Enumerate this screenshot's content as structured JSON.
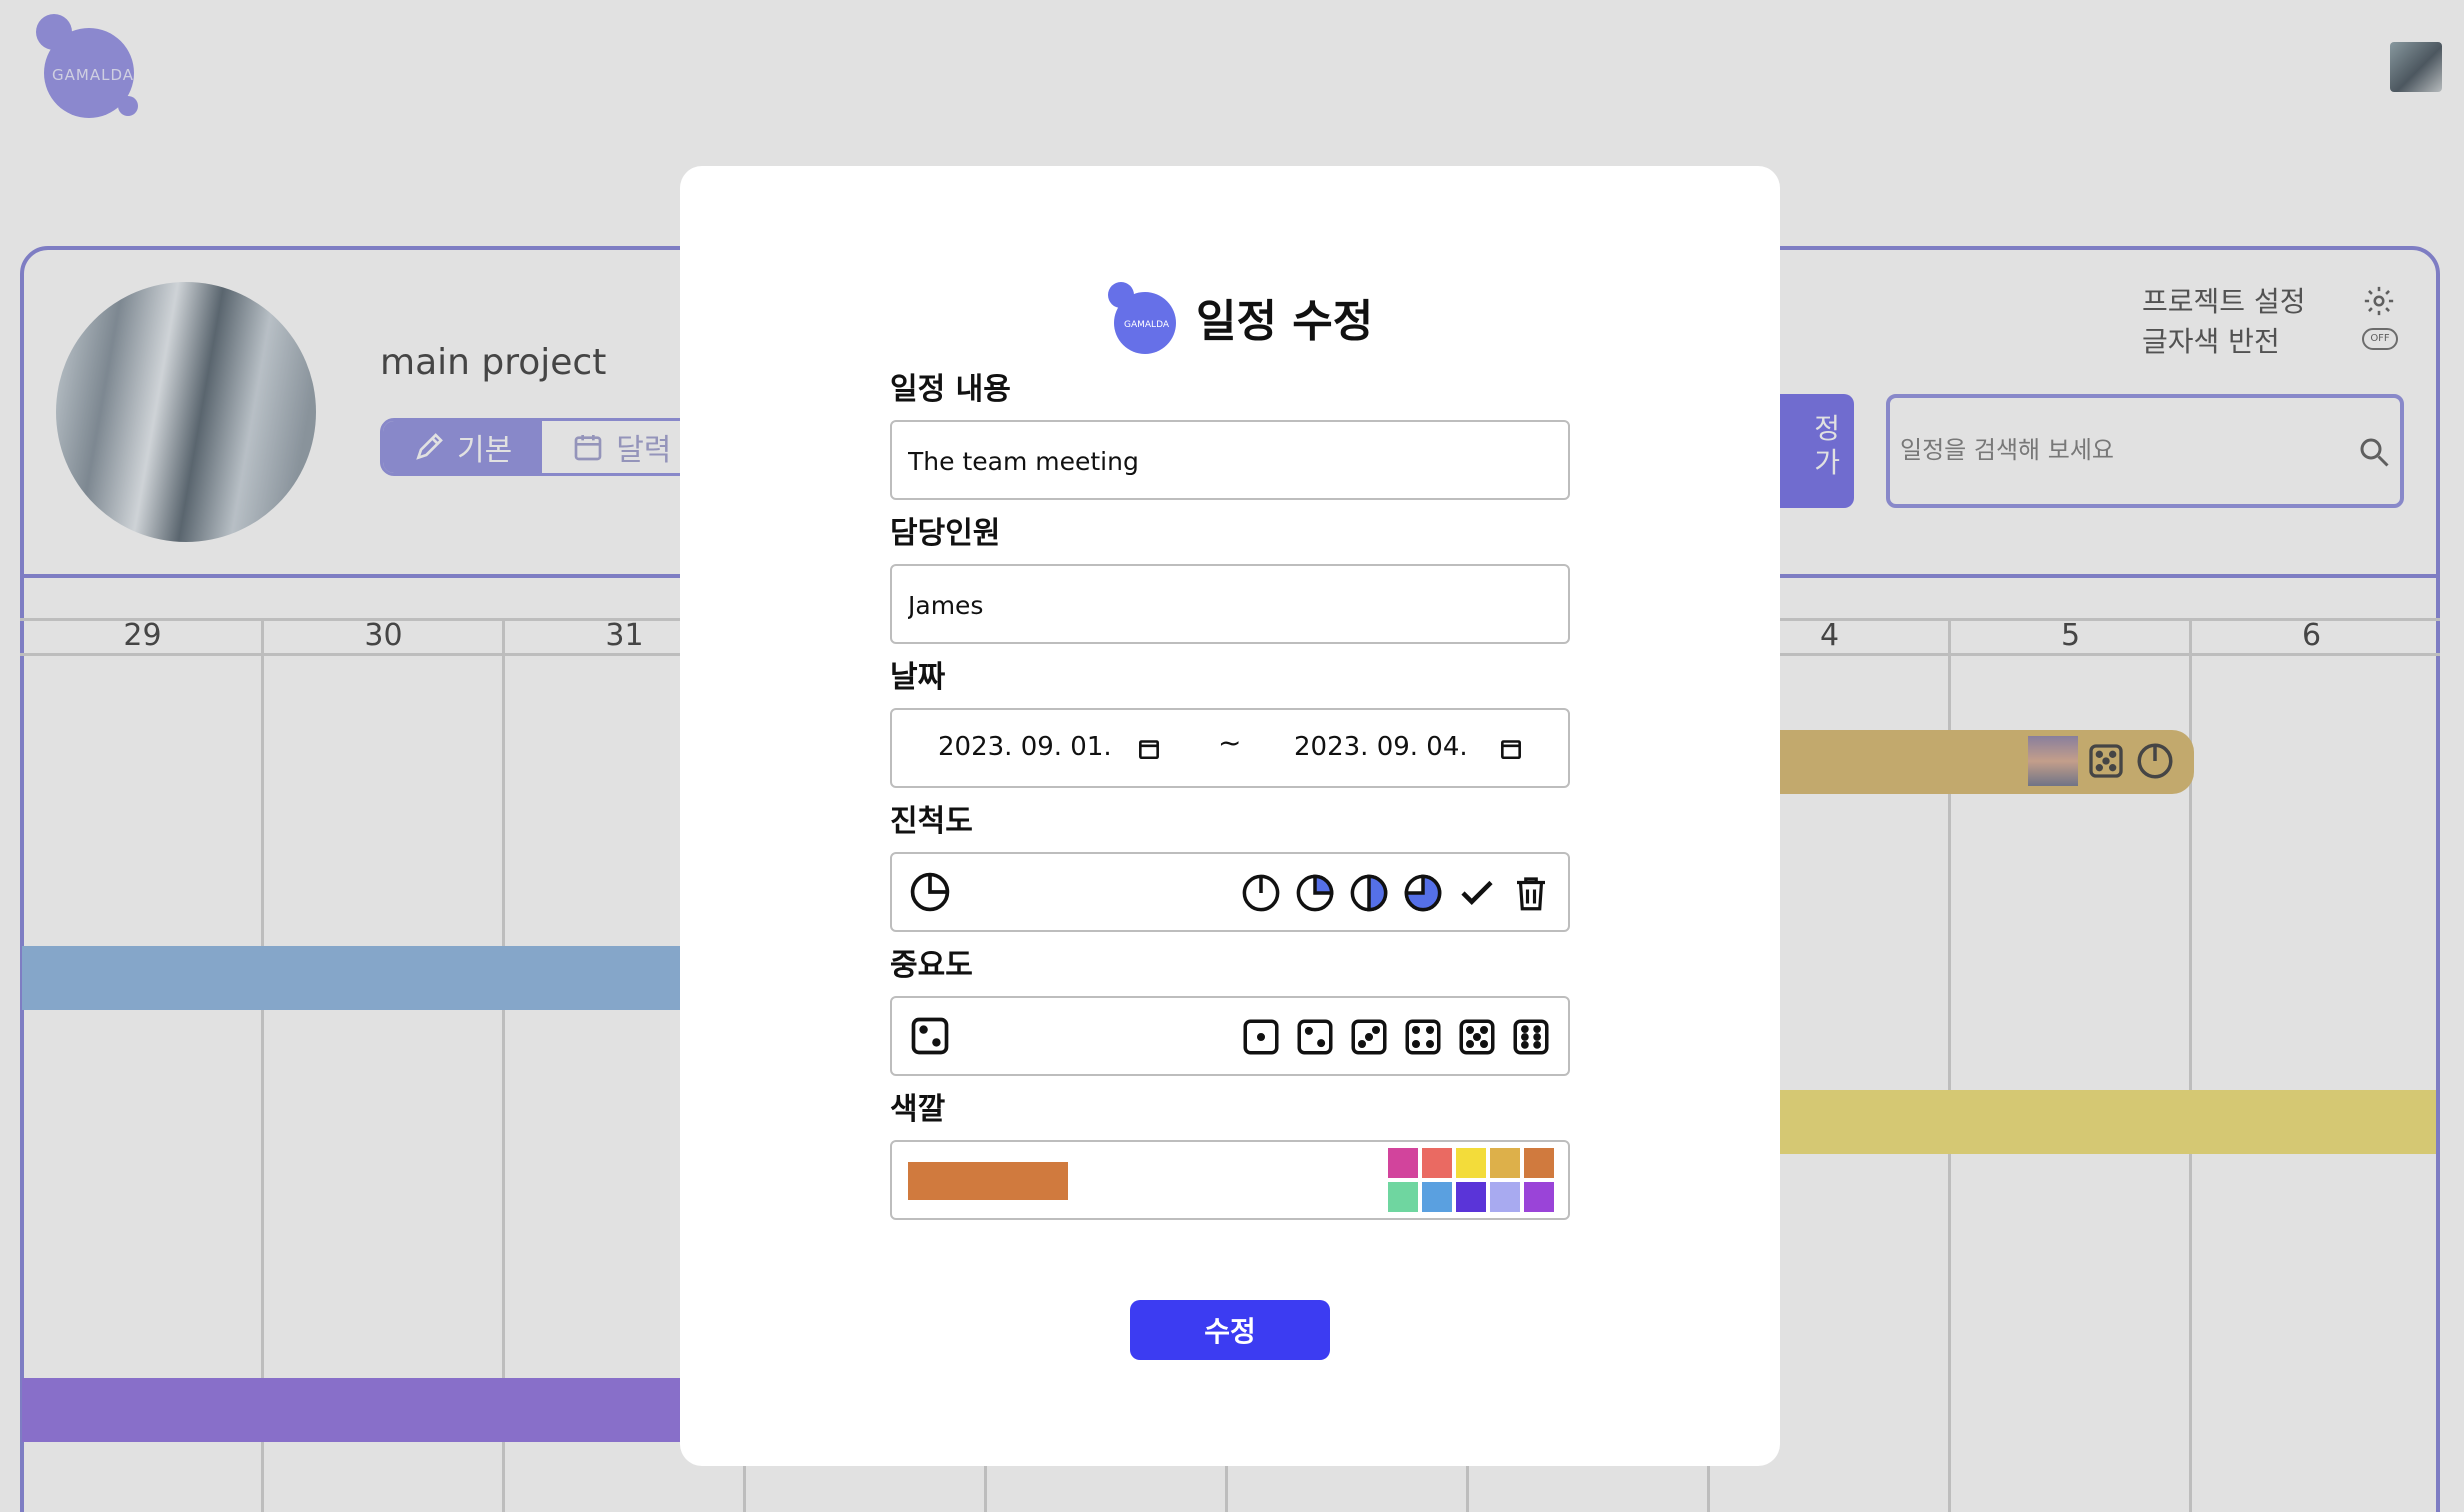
{
  "app": {
    "logo_text": "GAMALDA",
    "project_title": "main project",
    "tabs": [
      {
        "label": "기본",
        "icon": "pencil-icon"
      },
      {
        "label": "달력",
        "icon": "calendar-icon"
      }
    ],
    "settings": {
      "project_settings": "프로젝트 설정",
      "invert_text_color": "글자색 반전",
      "toggle_label": "OFF"
    },
    "add_button_label": "정\n가",
    "search": {
      "placeholder": "일정을 검색해 보세요",
      "icon": "search-icon"
    },
    "calendar": {
      "days": [
        "29",
        "30",
        "31",
        "",
        "",
        "",
        "",
        "4",
        "5",
        "6"
      ]
    },
    "events": [
      {
        "color": "#86b2e0"
      },
      {
        "color": "#8a6ae0"
      },
      {
        "color": "#d6b667"
      },
      {
        "color": "#f0de6f"
      }
    ]
  },
  "modal": {
    "logo_text": "GAMALDA",
    "title": "일정 수정",
    "content": {
      "label": "일정 내용",
      "value": "The team meeting"
    },
    "assignee": {
      "label": "담당인원",
      "value": "James"
    },
    "date": {
      "label": "날짜",
      "start": "2023. 09. 01.",
      "separator": "~",
      "end": "2023. 09. 04."
    },
    "progress": {
      "label": "진척도",
      "current_percent": 25,
      "options": [
        "progress-0-icon",
        "progress-25-icon",
        "progress-50-icon",
        "progress-75-icon",
        "complete-check-icon",
        "delete-trash-icon"
      ]
    },
    "importance": {
      "label": "중요도",
      "current": 2,
      "options": [
        1,
        2,
        3,
        4,
        5,
        6
      ]
    },
    "color": {
      "label": "색깔",
      "current": "#d07a3e",
      "palette": [
        "#d2449c",
        "#ea6a62",
        "#f3dc3a",
        "#ddb04a",
        "#d07a3e",
        "#6fd6a0",
        "#5aa0e0",
        "#5a34d8",
        "#a8aaf0",
        "#9a44d8"
      ]
    },
    "submit_label": "수정"
  }
}
